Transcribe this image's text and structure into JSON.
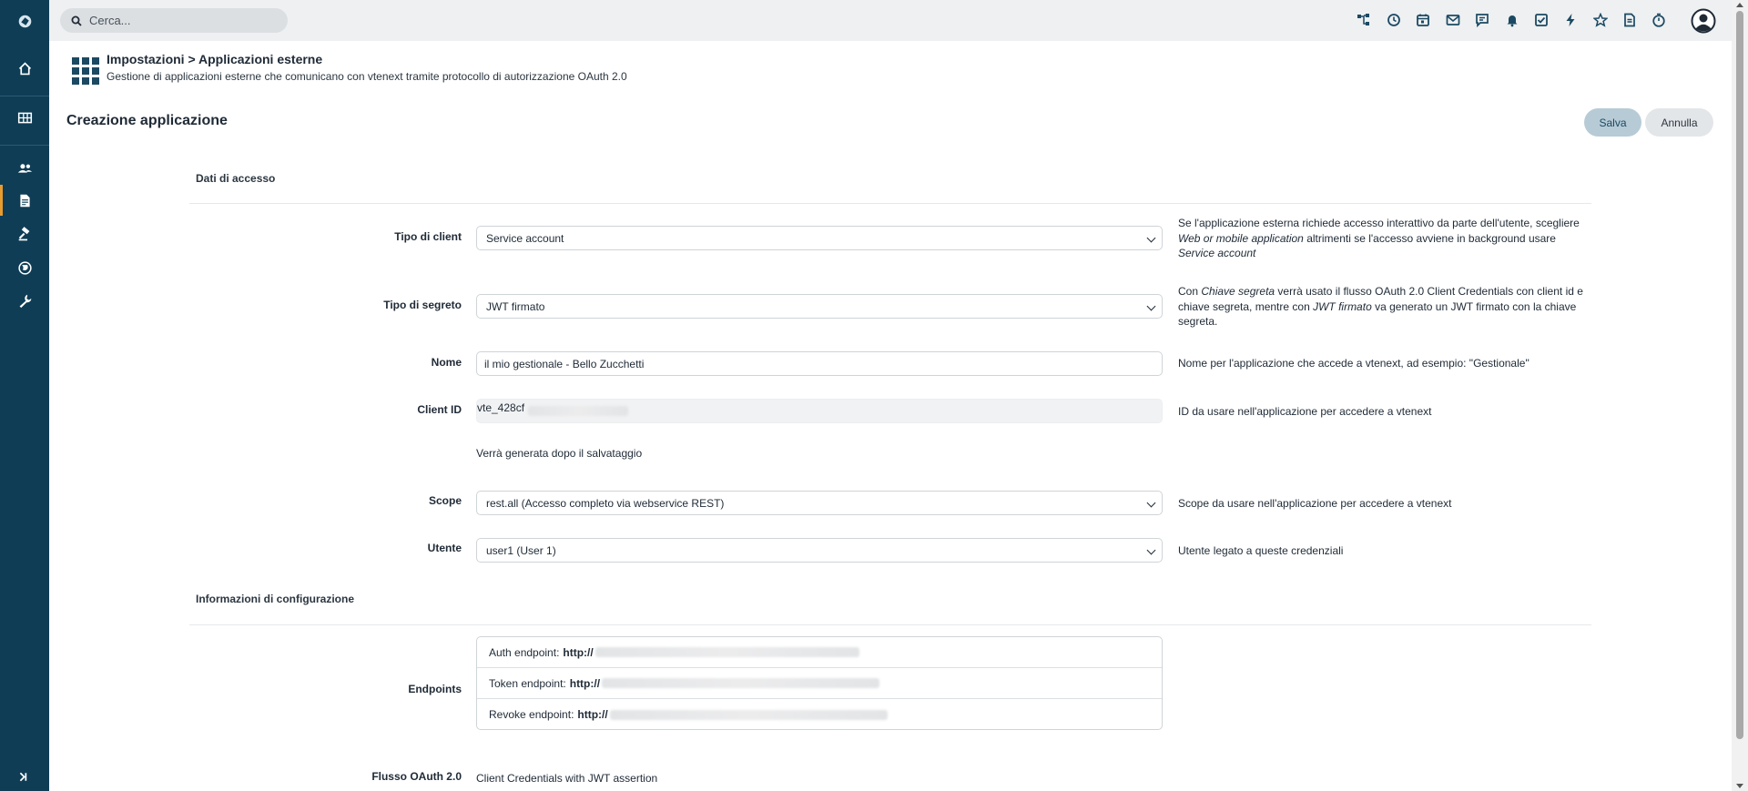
{
  "topbar": {
    "search_placeholder": "Cerca...",
    "icons": [
      "tree-icon",
      "history-icon",
      "calendar-icon",
      "mail-icon",
      "chat-icon",
      "bell-icon",
      "checkbox-icon",
      "bolt-icon",
      "star-icon",
      "document-icon",
      "timer-icon"
    ]
  },
  "sidebar": {
    "items": [
      "home-icon",
      "grid-icon",
      "users-icon",
      "documents-icon",
      "gavel-icon",
      "globe-icon",
      "wrench-icon"
    ],
    "active": "documents-icon"
  },
  "header": {
    "title": "Impostazioni > Applicazioni esterne",
    "subtitle": "Gestione di applicazioni esterne che comunicano con vtenext tramite protocollo di autorizzazione OAuth 2.0"
  },
  "page": {
    "title": "Creazione applicazione",
    "save_label": "Salva",
    "cancel_label": "Annulla"
  },
  "sections": {
    "access": "Dati di accesso",
    "config": "Informazioni di configurazione"
  },
  "form": {
    "client_type": {
      "label": "Tipo di client",
      "value": "Service account",
      "help_a": "Se l'applicazione esterna richiede accesso interattivo da parte dell'utente, scegliere ",
      "help_b": "Web or mobile application",
      "help_c": " altrimenti se l'accesso avviene in background usare ",
      "help_d": "Service account"
    },
    "secret_type": {
      "label": "Tipo di segreto",
      "value": "JWT firmato",
      "help_a": "Con ",
      "help_b": "Chiave segreta",
      "help_c": " verrà usato il flusso OAuth 2.0 Client Credentials con client id e chiave segreta, mentre con ",
      "help_d": "JWT firmato",
      "help_e": " va generato un JWT firmato con la chiave segreta."
    },
    "name": {
      "label": "Nome",
      "value": "il mio gestionale - Bello Zucchetti",
      "help": "Nome per l'applicazione che accede a vtenext, ad esempio: \"Gestionale\""
    },
    "client_id": {
      "label": "Client ID",
      "value": "vte_428cf",
      "help": "ID da usare nell'applicazione per accedere a vtenext",
      "note": "Verrà generata dopo il salvataggio"
    },
    "scope": {
      "label": "Scope",
      "value": "rest.all (Accesso completo via webservice REST)",
      "help": "Scope da usare nell'applicazione per accedere a vtenext"
    },
    "user": {
      "label": "Utente",
      "value": "user1 (User 1)",
      "help": "Utente legato a queste credenziali"
    }
  },
  "config": {
    "endpoints_label": "Endpoints",
    "auth_label": "Auth endpoint:",
    "auth_value": "http://",
    "token_label": "Token endpoint:",
    "token_value": "http://",
    "revoke_label": "Revoke endpoint:",
    "revoke_value": "http://",
    "flow_label": "Flusso OAuth 2.0",
    "flow_value": "Client Credentials with JWT assertion"
  }
}
